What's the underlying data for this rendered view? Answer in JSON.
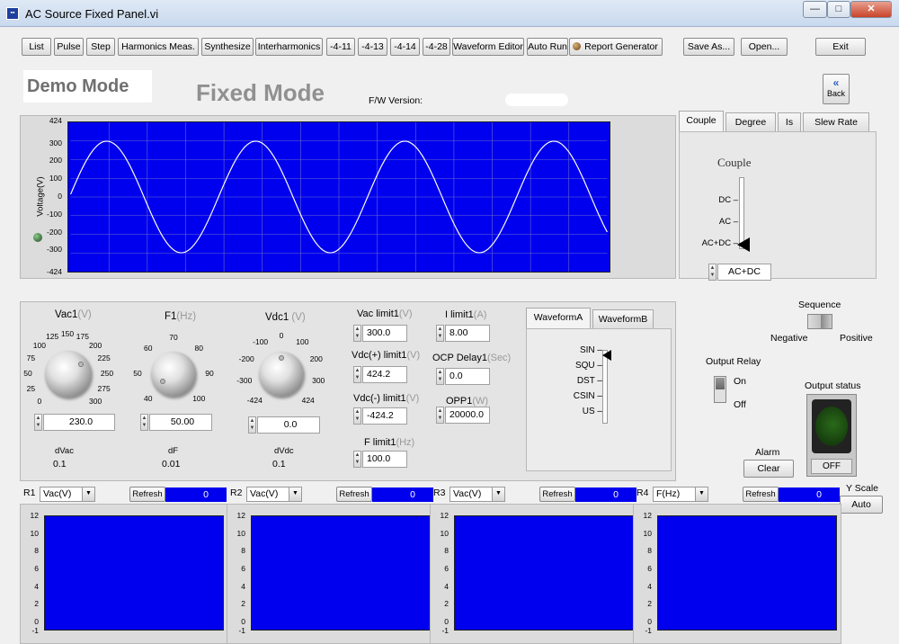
{
  "window": {
    "title": "AC Source Fixed Panel.vi",
    "icon": "labview-vi-icon",
    "minimize": "—",
    "maximize": "□",
    "close": "✕"
  },
  "toolbar": {
    "buttons": [
      "List",
      "Pulse",
      "Step",
      "Harmonics Meas.",
      "Synthesize",
      "Interharmonics",
      "-4-11",
      "-4-13",
      "-4-14",
      "-4-28",
      "Waveform Editor",
      "Auto Run"
    ],
    "report": "Report Generator",
    "save_as": "Save As...",
    "open": "Open...",
    "exit": "Exit"
  },
  "header": {
    "demo_mode": "Demo Mode",
    "fixed_mode": "Fixed Mode",
    "fw_version_label": "F/W Version:",
    "back_label": "Back"
  },
  "waveform_chart": {
    "ylabel": "Voltage(V)",
    "yticks": [
      "424",
      "300",
      "200",
      "100",
      "0",
      "-100",
      "-200",
      "-300",
      "-424"
    ],
    "ylim": [
      -424,
      424
    ],
    "amplitude": 317,
    "cycles": 3.6
  },
  "chart_data": [
    {
      "type": "line",
      "title": "",
      "ylabel": "Voltage(V)",
      "ylim": [
        -424,
        424
      ],
      "series": [
        {
          "values": [
            0,
            230,
            317,
            230,
            0,
            -230,
            -317,
            -230,
            0,
            230,
            317,
            230,
            0,
            -230,
            -317,
            -230,
            0,
            230,
            317,
            230,
            0,
            -230,
            -317,
            -230,
            0,
            230,
            317,
            230,
            0,
            -230
          ]
        }
      ]
    }
  ],
  "couple_tabs": {
    "tabs": [
      "Couple",
      "Degree",
      "Is",
      "Slew Rate"
    ],
    "title": "Couple",
    "options": [
      "DC",
      "AC",
      "AC+DC"
    ],
    "value": "AC+DC"
  },
  "controls": {
    "vac1": {
      "label": "Vac1",
      "unit": "(V)",
      "ticks": [
        "0",
        "25",
        "50",
        "75",
        "100",
        "125",
        "150",
        "175",
        "200",
        "225",
        "250",
        "275",
        "300"
      ],
      "value": "230.0",
      "delta_label": "dVac",
      "delta": "0.1"
    },
    "f1": {
      "label": "F1",
      "unit": "(Hz)",
      "ticks": [
        "40",
        "50",
        "60",
        "70",
        "80",
        "90",
        "100"
      ],
      "value": "50.00",
      "delta_label": "dF",
      "delta": "0.01"
    },
    "vdc1": {
      "label": "Vdc1",
      "unit": "(V)",
      "ticks": [
        "-424",
        "-300",
        "-200",
        "-100",
        "0",
        "100",
        "200",
        "300",
        "424"
      ],
      "value": "0.0",
      "delta_label": "dVdc",
      "delta": "0.1"
    },
    "vac_limit": {
      "label": "Vac limit1",
      "unit": "(V)",
      "value": "300.0"
    },
    "vdc_pos_limit": {
      "label": "Vdc(+) limit1",
      "unit": "(V)",
      "value": "424.2"
    },
    "vdc_neg_limit": {
      "label": "Vdc(-) limit1",
      "unit": "(V)",
      "value": "-424.2"
    },
    "f_limit": {
      "label": "F limit1",
      "unit": "(Hz)",
      "value": "100.0"
    },
    "i_limit": {
      "label": "I limit1",
      "unit": "(A)",
      "value": "8.00"
    },
    "ocp_delay": {
      "label": "OCP Delay1",
      "unit": "(Sec)",
      "value": "0.0"
    },
    "opp": {
      "label": "OPP1",
      "unit": "(W)",
      "value": "20000.0"
    }
  },
  "waveform_tabs": {
    "tabs": [
      "WaveformA",
      "WaveformB"
    ],
    "options": [
      "SIN",
      "SQU",
      "DST",
      "CSIN",
      "US"
    ],
    "value": "SIN"
  },
  "sequence": {
    "label": "Sequence",
    "left": "Negative",
    "right": "Positive"
  },
  "output_relay": {
    "label": "Output Relay",
    "on": "On",
    "off": "Off"
  },
  "output_status": {
    "label": "Output status",
    "button": "OFF"
  },
  "alarm": {
    "label": "Alarm",
    "button": "Clear"
  },
  "yscale": {
    "label": "Y Scale",
    "button": "Auto"
  },
  "readouts": [
    {
      "id": "R1",
      "select": "Vac(V)",
      "refresh": "Refresh",
      "value": "0"
    },
    {
      "id": "R2",
      "select": "Vac(V)",
      "refresh": "Refresh",
      "value": "0"
    },
    {
      "id": "R3",
      "select": "Vac(V)",
      "refresh": "Refresh",
      "value": "0"
    },
    {
      "id": "R4",
      "select": "F(Hz)",
      "refresh": "Refresh",
      "value": "0"
    }
  ],
  "mini_yticks": [
    "12",
    "10",
    "8",
    "6",
    "4",
    "2",
    "0",
    "-1"
  ]
}
